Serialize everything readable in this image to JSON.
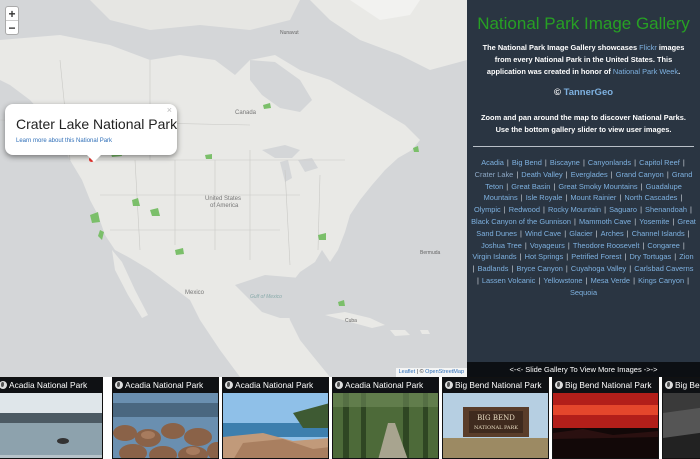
{
  "map": {
    "zoom_in": "+",
    "zoom_out": "−",
    "popup": {
      "title": "Crater Lake National Park",
      "link": "Learn more about this National Park",
      "close": "×"
    },
    "labels": {
      "usa": "United States",
      "usa2": "of America",
      "canada": "Canada",
      "mexico": "Mexico",
      "gulf": "Gulf of Mexico",
      "cuba": "Cuba",
      "bermuda": "Bermuda",
      "nunavut": "Nunavut"
    },
    "attribution": {
      "leaflet": "Leaflet",
      "sep": " | © ",
      "osm": "OpenStreetMap"
    }
  },
  "sidebar": {
    "title": "National Park Image Gallery",
    "intro_1": "The National Park Image Gallery showcases ",
    "intro_flickr": "Flickr",
    "intro_2": " images from every National Park in the United States. This application was created in honor of ",
    "intro_npw": "National Park Week",
    "intro_3": ".",
    "credit_symbol": "©",
    "credit_name": "TannerGeo",
    "instructions": "Zoom and pan around the map to discover National Parks. Use the bottom gallery slider to view user images.",
    "parks": [
      "Acadia",
      "Big Bend",
      "Biscayne",
      "Canyonlands",
      "Capitol Reef",
      "Crater Lake",
      "Death Valley",
      "Everglades",
      "Grand Canyon",
      "Grand Teton",
      "Great Basin",
      "Great Smoky Mountains",
      "Guadalupe Mountains",
      "Isle Royale",
      "Mount Rainier",
      "North Cascades",
      "Olympic",
      "Redwood",
      "Rocky Mountain",
      "Saguaro",
      "Shenandoah",
      "Black Canyon of the Gunnison",
      "Mammoth Cave",
      "Yosemite",
      "Great Sand Dunes",
      "Wind Cave",
      "Glacier",
      "Arches",
      "Channel Islands",
      "Joshua Tree",
      "Voyageurs",
      "Theodore Roosevelt",
      "Congaree",
      "Virgin Islands",
      "Hot Springs",
      "Petrified Forest",
      "Dry Tortugas",
      "Zion",
      "Badlands",
      "Bryce Canyon",
      "Cuyahoga Valley",
      "Carlsbad Caverns",
      "Lassen Volcanic",
      "Yellowstone",
      "Mesa Verde",
      "Kings Canyon",
      "Sequoia"
    ],
    "selected_park": "Crater Lake",
    "separator": "|"
  },
  "gallery_bar": "<-<- Slide Gallery To View More Images ->->",
  "gallery": [
    {
      "caption": "Acadia National Park",
      "scene": "sea"
    },
    {
      "caption": "Acadia National Park",
      "scene": "rocks"
    },
    {
      "caption": "Acadia National Park",
      "scene": "coast"
    },
    {
      "caption": "Acadia National Park",
      "scene": "forest"
    },
    {
      "caption": "Big Bend National Park",
      "scene": "sign"
    },
    {
      "caption": "Big Bend National Park",
      "scene": "sunset"
    },
    {
      "caption": "Big Bend National Park",
      "scene": "dark"
    }
  ],
  "colors": {
    "park_green": "#27a024",
    "link_blue": "#7eb1e0",
    "sidebar_bg": "#2a3542",
    "map_land": "#e9e9e6",
    "map_water": "#d4d6d8"
  }
}
